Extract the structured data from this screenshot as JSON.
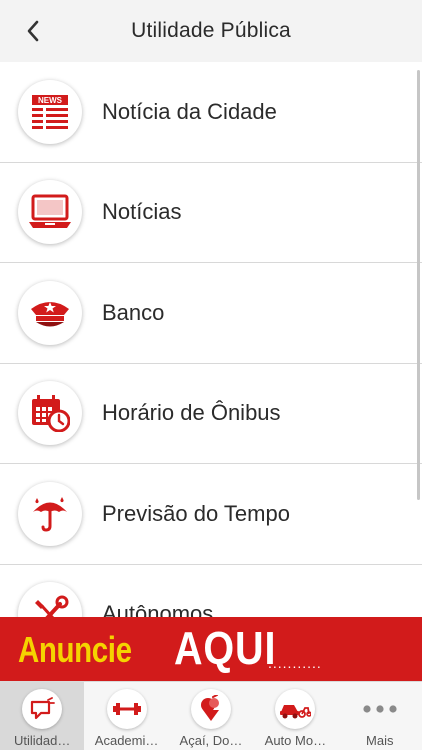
{
  "header": {
    "title": "Utilidade Pública"
  },
  "list": [
    {
      "label": "Notícia da Cidade",
      "icon": "news-icon"
    },
    {
      "label": "Notícias",
      "icon": "laptop-icon"
    },
    {
      "label": "Banco",
      "icon": "police-cap-icon"
    },
    {
      "label": "Horário de Ônibus",
      "icon": "calendar-clock-icon"
    },
    {
      "label": "Previsão do Tempo",
      "icon": "umbrella-rain-icon"
    },
    {
      "label": "Autônomos",
      "icon": "tools-icon"
    }
  ],
  "banner": {
    "part1": "Anuncie",
    "part2": "AQUI",
    "dots": "..........."
  },
  "tabs": [
    {
      "label": "Utilidad…",
      "icon": "megaphone-icon",
      "active": true
    },
    {
      "label": "Academi…",
      "icon": "dumbbell-icon"
    },
    {
      "label": "Açaí, Do…",
      "icon": "ice-cream-icon"
    },
    {
      "label": "Auto Mo…",
      "icon": "car-moto-icon"
    },
    {
      "label": "Mais",
      "icon": "more-dots-icon"
    }
  ],
  "colors": {
    "accent": "#d21b1b",
    "banner_text": "#f5d300",
    "header_bg": "#f3f3f3"
  }
}
